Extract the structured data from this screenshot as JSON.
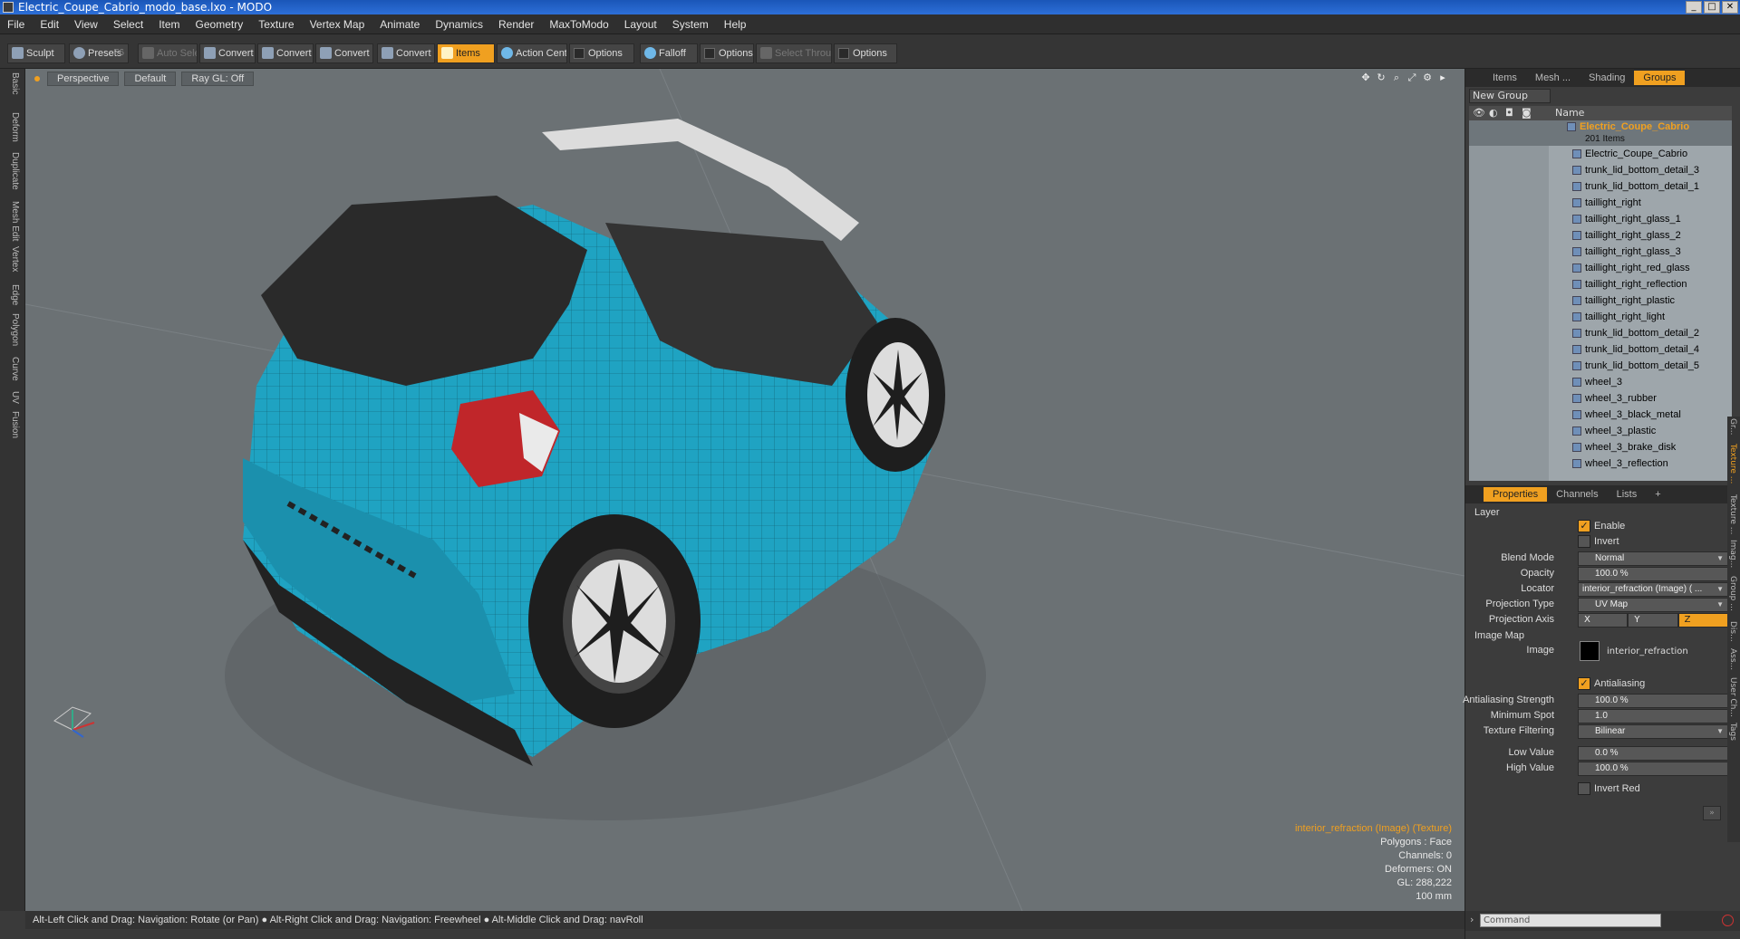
{
  "window": {
    "title": "Electric_Coupe_Cabrio_modo_base.lxo - MODO"
  },
  "menu": [
    "File",
    "Edit",
    "View",
    "Select",
    "Item",
    "Geometry",
    "Texture",
    "Vertex Map",
    "Animate",
    "Dynamics",
    "Render",
    "MaxToModo",
    "Layout",
    "System",
    "Help"
  ],
  "toolbar": {
    "sculpt": "Sculpt",
    "presets": "Presets",
    "presets_key": "F6",
    "auto_select": "Auto Select",
    "convert1": "Convert",
    "convert2": "Convert",
    "convert3": "Convert",
    "convert4": "Convert",
    "items": "Items",
    "action_center": "Action Center",
    "options1": "Options",
    "falloff": "Falloff",
    "options2": "Options",
    "select_through": "Select Through",
    "options3": "Options"
  },
  "left_tabs": [
    "Basic",
    "Deform",
    "Duplicate",
    "Mesh Edit",
    "Vertex",
    "Edge",
    "Polygon",
    "Curve",
    "UV",
    "Fusion"
  ],
  "viewport": {
    "view": "Perspective",
    "shading": "Default",
    "raygl": "Ray GL: Off",
    "info": {
      "texture": "interior_refraction (Image) (Texture)",
      "polygons": "Polygons : Face",
      "channels": "Channels: 0",
      "deformers": "Deformers: ON",
      "gl": "GL: 288,222",
      "scale": "100 mm"
    },
    "colors": {
      "body": "#1fa3c2",
      "dark": "#2a2a2a",
      "taillight": "#c0262a"
    }
  },
  "status": "Alt-Left Click and Drag: Navigation: Rotate (or Pan) ● Alt-Right Click and Drag: Navigation: Freewheel ● Alt-Middle Click and Drag: navRoll",
  "items_panel": {
    "tabs": [
      "Items",
      "Mesh ...",
      "Shading",
      "Groups"
    ],
    "active_tab": "Groups",
    "new_group": "New Group",
    "column_name": "Name",
    "group": {
      "name": "Electric_Coupe_Cabrio",
      "count": "201 Items"
    },
    "items": [
      "Electric_Coupe_Cabrio",
      "trunk_lid_bottom_detail_3",
      "trunk_lid_bottom_detail_1",
      "taillight_right",
      "taillight_right_glass_1",
      "taillight_right_glass_2",
      "taillight_right_glass_3",
      "taillight_right_red_glass",
      "taillight_right_reflection",
      "taillight_right_plastic",
      "taillight_right_light",
      "trunk_lid_bottom_detail_2",
      "trunk_lid_bottom_detail_4",
      "trunk_lid_bottom_detail_5",
      "wheel_3",
      "wheel_3_rubber",
      "wheel_3_black_metal",
      "wheel_3_plastic",
      "wheel_3_brake_disk",
      "wheel_3_reflection"
    ]
  },
  "properties_panel": {
    "tabs": [
      "Properties",
      "Channels",
      "Lists"
    ],
    "active_tab": "Properties",
    "layer": "Layer",
    "enable": "Enable",
    "invert": "Invert",
    "blend_mode_label": "Blend Mode",
    "blend_mode": "Normal",
    "opacity_label": "Opacity",
    "opacity": "100.0 %",
    "locator_label": "Locator",
    "locator": "interior_refraction (Image) ( ...",
    "projection_type_label": "Projection Type",
    "projection_type": "UV Map",
    "projection_axis_label": "Projection Axis",
    "axes": [
      "X",
      "Y",
      "Z"
    ],
    "active_axis": "Z",
    "image_map": "Image Map",
    "image_label": "Image",
    "image": "interior_refraction",
    "antialiasing": "Antialiasing",
    "aa_strength_label": "Antialiasing Strength",
    "aa_strength": "100.0 %",
    "min_spot_label": "Minimum Spot",
    "min_spot": "1.0",
    "tex_filter_label": "Texture Filtering",
    "tex_filter": "Bilinear",
    "low_value_label": "Low Value",
    "low_value": "0.0 %",
    "high_value_label": "High Value",
    "high_value": "100.0 %",
    "invert_red": "Invert Red",
    "side_tabs": [
      "Gr...",
      "Texture ...",
      "Texture ...",
      "Imag...",
      "Group ...",
      "Dis...",
      "Ass...",
      "User Ch...",
      "Tags"
    ]
  },
  "command": {
    "placeholder": "Command"
  }
}
